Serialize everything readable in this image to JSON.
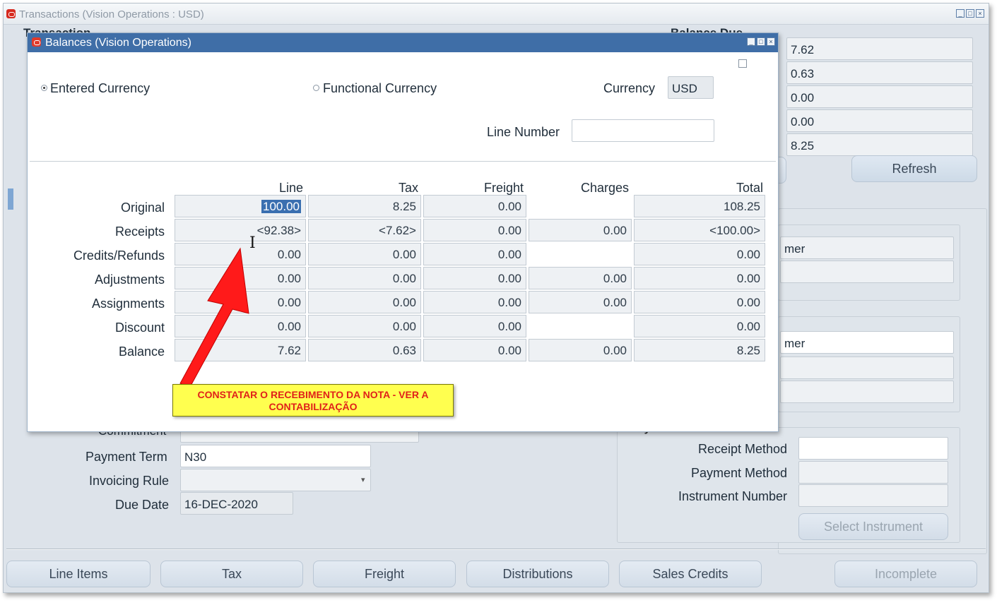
{
  "back_window": {
    "title": "Transactions (Vision Operations : USD)",
    "header_left": "Transaction",
    "header_right": "Balance Due",
    "balance_values": [
      "7.62",
      "0.63",
      "0.00",
      "0.00",
      "8.25"
    ],
    "refresh_label": "Refresh",
    "mer_top": "mer",
    "mer_mid": "mer",
    "commitment_label": "Commitment",
    "payment_term": {
      "label": "Payment Term",
      "value": "N30"
    },
    "invoicing_rule": {
      "label": "Invoicing Rule",
      "value": ""
    },
    "due_date": {
      "label": "Due Date",
      "value": "16-DEC-2020"
    },
    "payment_details_label": "Payment Details",
    "receipt_method": {
      "label": "Receipt Method",
      "value": ""
    },
    "payment_method": {
      "label": "Payment Method",
      "value": ""
    },
    "instrument_number": {
      "label": "Instrument Number",
      "value": ""
    },
    "select_instrument_label": "Select Instrument",
    "bottom_buttons": [
      "Line Items",
      "Tax",
      "Freight",
      "Distributions",
      "Sales Credits",
      "Incomplete"
    ]
  },
  "dialog": {
    "title": "Balances (Vision Operations)",
    "entered_currency": "Entered Currency",
    "functional_currency": "Functional Currency",
    "currency_label": "Currency",
    "currency_value": "USD",
    "line_number_label": "Line Number",
    "line_number_value": "",
    "columns": [
      "Line",
      "Tax",
      "Freight",
      "Charges",
      "Total"
    ],
    "rows": [
      {
        "label": "Original",
        "values": [
          "100.00",
          "8.25",
          "0.00",
          null,
          "108.25"
        ]
      },
      {
        "label": "Receipts",
        "values": [
          "<92.38>",
          "<7.62>",
          "0.00",
          "0.00",
          "<100.00>"
        ]
      },
      {
        "label": "Credits/Refunds",
        "values": [
          "0.00",
          "0.00",
          "0.00",
          null,
          "0.00"
        ]
      },
      {
        "label": "Adjustments",
        "values": [
          "0.00",
          "0.00",
          "0.00",
          "0.00",
          "0.00"
        ]
      },
      {
        "label": "Assignments",
        "values": [
          "0.00",
          "0.00",
          "0.00",
          "0.00",
          "0.00"
        ]
      },
      {
        "label": "Discount",
        "values": [
          "0.00",
          "0.00",
          "0.00",
          null,
          "0.00"
        ]
      },
      {
        "label": "Balance",
        "values": [
          "7.62",
          "0.63",
          "0.00",
          "0.00",
          "8.25"
        ]
      }
    ]
  },
  "annotation": {
    "text_line1": "CONSTATAR O RECEBIMENTO DA NOTA - VER A",
    "text_line2": "CONTABILIZAÇÃO",
    "arrow_color": "#ff1a1a"
  },
  "cursor_glyph": "I"
}
